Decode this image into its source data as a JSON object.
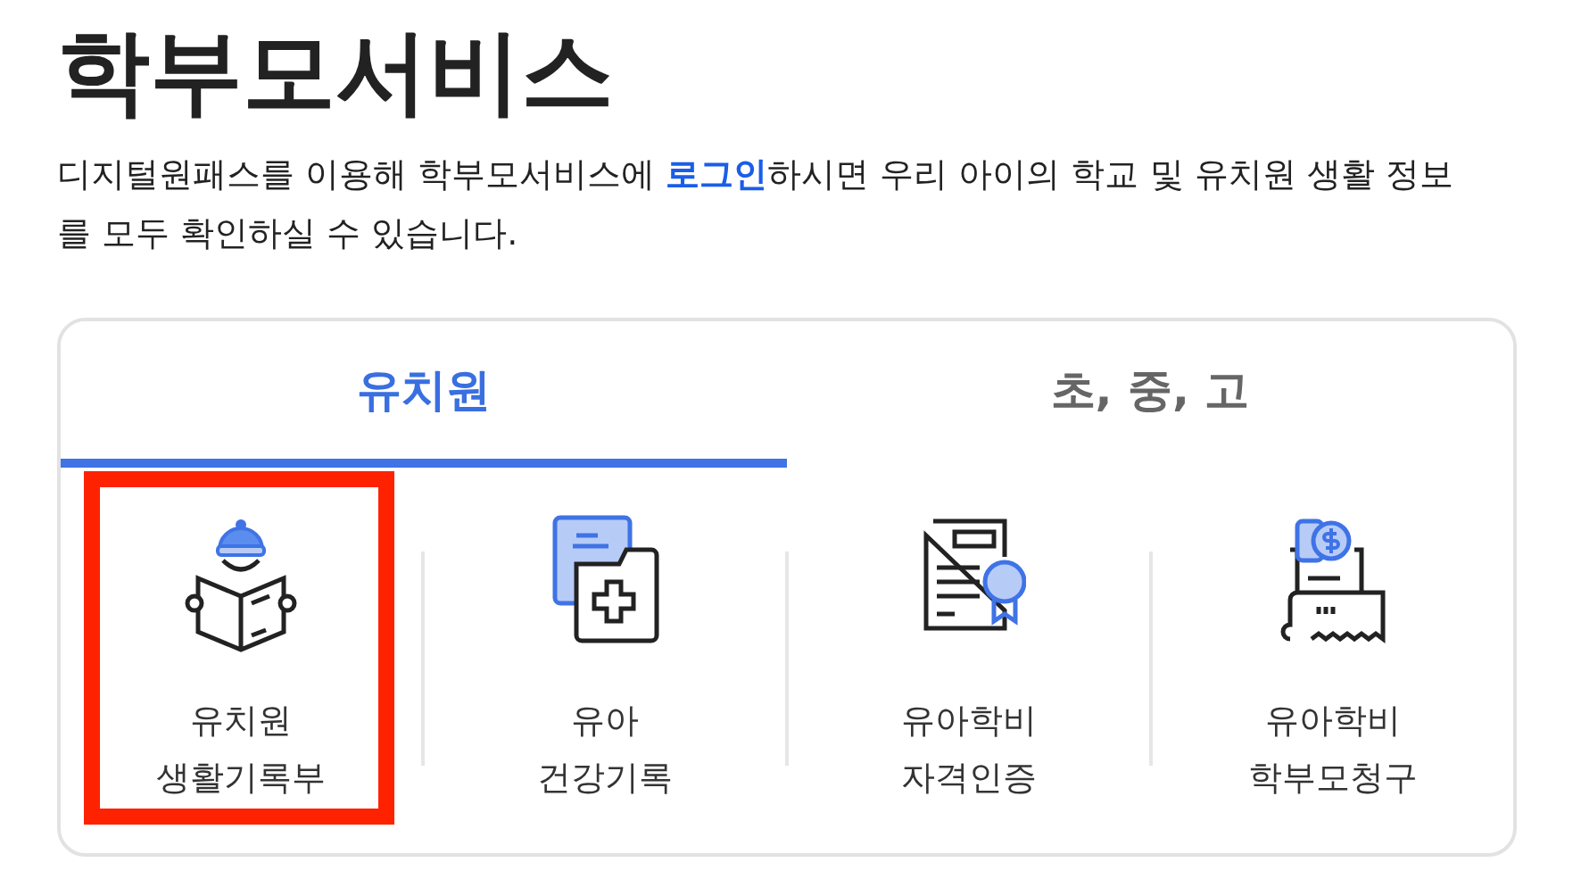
{
  "title": "학부모서비스",
  "intro": {
    "before": "디지털원패스를 이용해 학부모서비스에 ",
    "link": "로그인",
    "after": "하시면 우리 아이의 학교 및 유치원 생활 정보를 모두 확인하실 수 있습니다."
  },
  "tabs": [
    {
      "label": "유치원",
      "selected": true
    },
    {
      "label": "초, 중, 고",
      "selected": false
    }
  ],
  "services": [
    {
      "kind": "reader",
      "line1": "유치원",
      "line2": "생활기록부",
      "highlighted": true
    },
    {
      "kind": "health",
      "line1": "유아",
      "line2": "건강기록",
      "highlighted": false
    },
    {
      "kind": "certificate",
      "line1": "유아학비",
      "line2": "자격인증",
      "highlighted": false
    },
    {
      "kind": "bill",
      "line1": "유아학비",
      "line2": "학부모청구",
      "highlighted": false
    }
  ]
}
